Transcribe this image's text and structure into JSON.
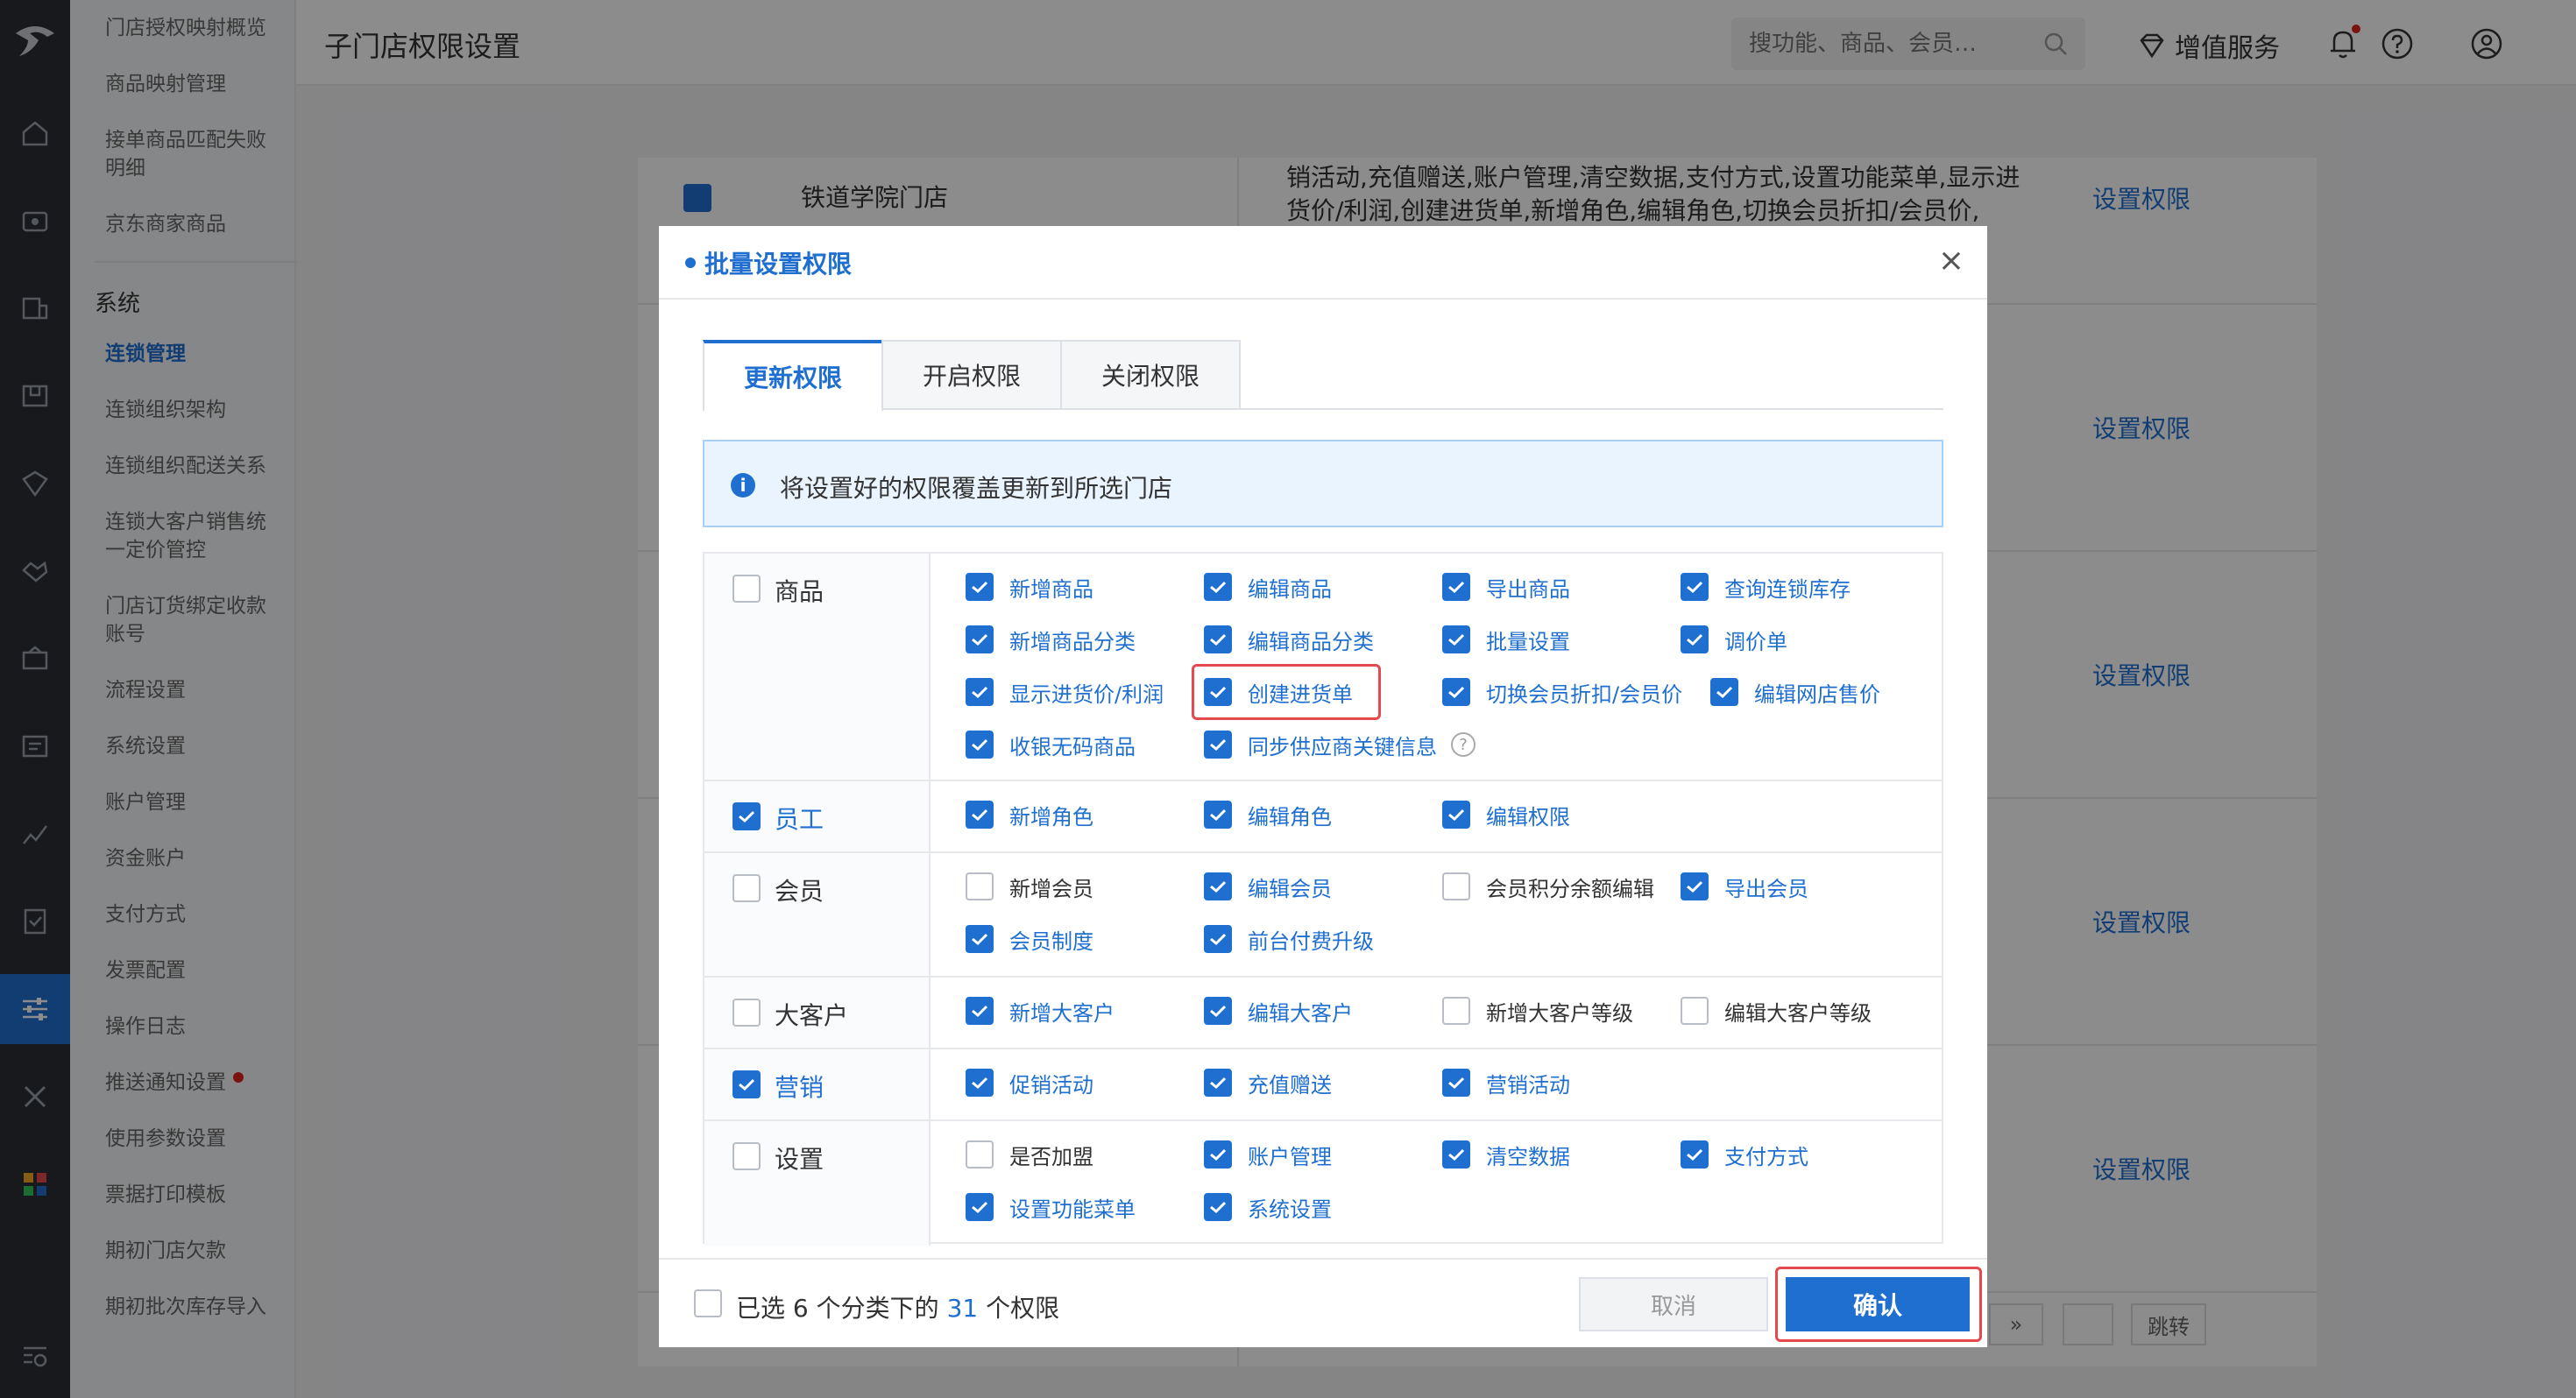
{
  "header": {
    "page_title": "子门店权限设置",
    "search_placeholder": "搜功能、商品、会员…",
    "vip_label": "增值服务"
  },
  "submenu": {
    "items_top": [
      "门店授权映射概览",
      "商品映射管理",
      "接单商品匹配失败明细",
      "京东商家商品"
    ],
    "section_title": "系统",
    "items": [
      "连锁管理",
      "连锁组织架构",
      "连锁组织配送关系",
      "连锁大客户销售统一定价管控",
      "门店订货绑定收款账号",
      "流程设置",
      "系统设置",
      "账户管理",
      "资金账户",
      "支付方式",
      "发票配置",
      "操作日志",
      "推送通知设置",
      "使用参数设置",
      "票据打印模板",
      "期初门店欠款",
      "期初批次库存导入"
    ],
    "active_item": "连锁管理"
  },
  "background": {
    "store_name": "铁道学院门店",
    "perm_text": "销活动,充值赠送,账户管理,清空数据,支付方式,设置功能菜单,显示进货价/利润,创建进货单,新增角色,编辑角色,切换会员折扣/会员价,",
    "set_link": "设置权限",
    "pager_jump": "跳转",
    "pager_next": "»"
  },
  "modal": {
    "title": "批量设置权限",
    "close": "×",
    "tabs": [
      "更新权限",
      "开启权限",
      "关闭权限"
    ],
    "info": "将设置好的权限覆盖更新到所选门店",
    "categories": [
      {
        "name": "商品",
        "checked": false,
        "options": [
          {
            "label": "新增商品",
            "checked": true
          },
          {
            "label": "编辑商品",
            "checked": true
          },
          {
            "label": "导出商品",
            "checked": true
          },
          {
            "label": "查询连锁库存",
            "checked": true
          },
          {
            "label": "新增商品分类",
            "checked": true
          },
          {
            "label": "编辑商品分类",
            "checked": true
          },
          {
            "label": "批量设置",
            "checked": true
          },
          {
            "label": "调价单",
            "checked": true
          },
          {
            "label": "显示进货价/利润",
            "checked": true
          },
          {
            "label": "创建进货单",
            "checked": true
          },
          {
            "label": "切换会员折扣/会员价",
            "checked": true
          },
          {
            "label": "编辑网店售价",
            "checked": true
          },
          {
            "label": "收银无码商品",
            "checked": true
          },
          {
            "label": "同步供应商关键信息",
            "checked": true
          }
        ]
      },
      {
        "name": "员工",
        "checked": true,
        "options": [
          {
            "label": "新增角色",
            "checked": true
          },
          {
            "label": "编辑角色",
            "checked": true
          },
          {
            "label": "编辑权限",
            "checked": true
          }
        ]
      },
      {
        "name": "会员",
        "checked": false,
        "options": [
          {
            "label": "新增会员",
            "checked": false
          },
          {
            "label": "编辑会员",
            "checked": true
          },
          {
            "label": "会员积分余额编辑",
            "checked": false
          },
          {
            "label": "导出会员",
            "checked": true
          },
          {
            "label": "会员制度",
            "checked": true
          },
          {
            "label": "前台付费升级",
            "checked": true
          }
        ]
      },
      {
        "name": "大客户",
        "checked": false,
        "options": [
          {
            "label": "新增大客户",
            "checked": true
          },
          {
            "label": "编辑大客户",
            "checked": true
          },
          {
            "label": "新增大客户等级",
            "checked": false
          },
          {
            "label": "编辑大客户等级",
            "checked": false
          }
        ]
      },
      {
        "name": "营销",
        "checked": true,
        "options": [
          {
            "label": "促销活动",
            "checked": true
          },
          {
            "label": "充值赠送",
            "checked": true
          },
          {
            "label": "营销活动",
            "checked": true
          }
        ]
      },
      {
        "name": "设置",
        "checked": false,
        "options": [
          {
            "label": "是否加盟",
            "checked": false
          },
          {
            "label": "账户管理",
            "checked": true
          },
          {
            "label": "清空数据",
            "checked": true
          },
          {
            "label": "支付方式",
            "checked": true
          },
          {
            "label": "设置功能菜单",
            "checked": true
          },
          {
            "label": "系统设置",
            "checked": true
          }
        ]
      }
    ],
    "footer": {
      "prefix": "已选",
      "category_count": "6",
      "middle": "个分类下的",
      "perm_count": "31",
      "suffix": "个权限"
    },
    "cancel_label": "取消",
    "confirm_label": "确认"
  },
  "colors": {
    "accent": "#1f6fd1",
    "highlight": "#e5484d",
    "rail": "#2b2f36"
  }
}
